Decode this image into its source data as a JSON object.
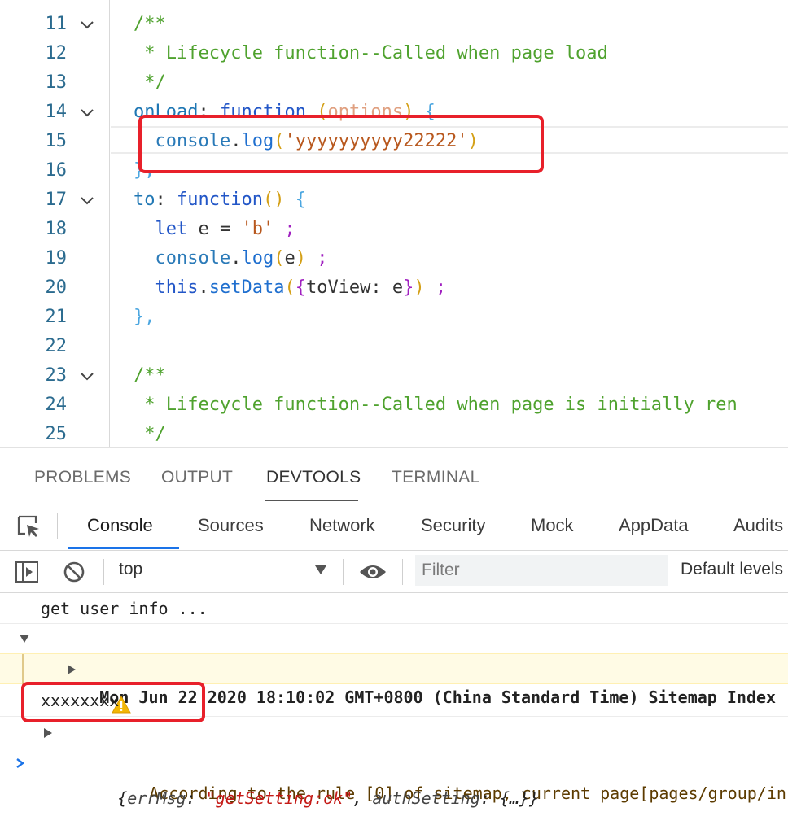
{
  "editor": {
    "lines": [
      {
        "num": "11",
        "fold": true,
        "segs": [
          {
            "t": "/**",
            "c": "c-com"
          }
        ]
      },
      {
        "num": "12",
        "fold": false,
        "segs": [
          {
            "t": " * Lifecycle function--Called when page load",
            "c": "c-com"
          }
        ]
      },
      {
        "num": "13",
        "fold": false,
        "segs": [
          {
            "t": " */",
            "c": "c-com"
          }
        ]
      },
      {
        "num": "14",
        "fold": true,
        "segs": [
          {
            "t": "onLoad",
            "c": "c-key"
          },
          {
            "t": ": ",
            "c": "c-pun"
          },
          {
            "t": "function",
            "c": "c-kw"
          },
          {
            "t": " ",
            "c": "c-pun"
          },
          {
            "t": "(",
            "c": "c-par"
          },
          {
            "t": "options",
            "c": "c-prm"
          },
          {
            "t": ") ",
            "c": "c-par"
          },
          {
            "t": "{",
            "c": "c-brk"
          }
        ]
      },
      {
        "num": "15",
        "fold": false,
        "segs": [
          {
            "t": "  console",
            "c": "c-obj"
          },
          {
            "t": ".",
            "c": "c-pun"
          },
          {
            "t": "log",
            "c": "c-fn"
          },
          {
            "t": "(",
            "c": "c-par"
          },
          {
            "t": "'yyyyyyyyyy22222'",
            "c": "c-str"
          },
          {
            "t": ")",
            "c": "c-par"
          }
        ]
      },
      {
        "num": "16",
        "fold": false,
        "segs": [
          {
            "t": "},",
            "c": "c-brk"
          }
        ]
      },
      {
        "num": "17",
        "fold": true,
        "segs": [
          {
            "t": "to",
            "c": "c-key"
          },
          {
            "t": ": ",
            "c": "c-pun"
          },
          {
            "t": "function",
            "c": "c-kw"
          },
          {
            "t": "() ",
            "c": "c-par"
          },
          {
            "t": "{",
            "c": "c-brk"
          }
        ]
      },
      {
        "num": "18",
        "fold": false,
        "segs": [
          {
            "t": "  let",
            "c": "c-kw"
          },
          {
            "t": " e = ",
            "c": "c-pun"
          },
          {
            "t": "'b'",
            "c": "c-str"
          },
          {
            "t": " ;",
            "c": "c-semi"
          }
        ]
      },
      {
        "num": "19",
        "fold": false,
        "segs": [
          {
            "t": "  console",
            "c": "c-obj"
          },
          {
            "t": ".",
            "c": "c-pun"
          },
          {
            "t": "log",
            "c": "c-fn"
          },
          {
            "t": "(",
            "c": "c-par"
          },
          {
            "t": "e",
            "c": "c-pun"
          },
          {
            "t": ")",
            "c": "c-par"
          },
          {
            "t": " ;",
            "c": "c-semi"
          }
        ]
      },
      {
        "num": "20",
        "fold": false,
        "segs": [
          {
            "t": "  this",
            "c": "c-kw"
          },
          {
            "t": ".",
            "c": "c-pun"
          },
          {
            "t": "setData",
            "c": "c-fn"
          },
          {
            "t": "(",
            "c": "c-par"
          },
          {
            "t": "{",
            "c": "c-mag"
          },
          {
            "t": "toView: e",
            "c": "c-pun"
          },
          {
            "t": "}",
            "c": "c-mag"
          },
          {
            "t": ")",
            "c": "c-par"
          },
          {
            "t": " ;",
            "c": "c-semi"
          }
        ]
      },
      {
        "num": "21",
        "fold": false,
        "segs": [
          {
            "t": "},",
            "c": "c-brk"
          }
        ]
      },
      {
        "num": "22",
        "fold": false,
        "segs": []
      },
      {
        "num": "23",
        "fold": true,
        "segs": [
          {
            "t": "/**",
            "c": "c-com"
          }
        ]
      },
      {
        "num": "24",
        "fold": false,
        "segs": [
          {
            "t": " * Lifecycle function--Called when page is initially ren",
            "c": "c-com"
          }
        ]
      },
      {
        "num": "25",
        "fold": false,
        "segs": [
          {
            "t": " */",
            "c": "c-com"
          }
        ]
      }
    ]
  },
  "panel": {
    "tabs": [
      "PROBLEMS",
      "OUTPUT",
      "DEVTOOLS",
      "TERMINAL"
    ],
    "active_tab": "DEVTOOLS"
  },
  "devtools": {
    "tabs": [
      "Console",
      "Sources",
      "Network",
      "Security",
      "Mock",
      "AppData",
      "Audits"
    ],
    "active_tab": "Console"
  },
  "toolbar": {
    "context": "top",
    "filter_placeholder": "Filter",
    "levels": "Default levels"
  },
  "console": {
    "line1": "get user info ...",
    "group_head": "Mon Jun 22 2020 18:10:02 GMT+0800 (China Standard Time) Sitemap Index",
    "warning": "According to the rule [0] of sitemap, current page[pages/group/in",
    "log_x": "xxxxxxxx",
    "obj_open": "{",
    "obj_key1": "errMsg",
    "obj_colon1": ": ",
    "obj_val1": "\"getSetting:ok\"",
    "obj_sep": ", ",
    "obj_key2": "authSetting",
    "obj_colon2": ": ",
    "obj_rest": "{…}}"
  },
  "colors": {
    "highlight_box": "#e8202a",
    "active_tab_underline": "#1a73e8"
  }
}
